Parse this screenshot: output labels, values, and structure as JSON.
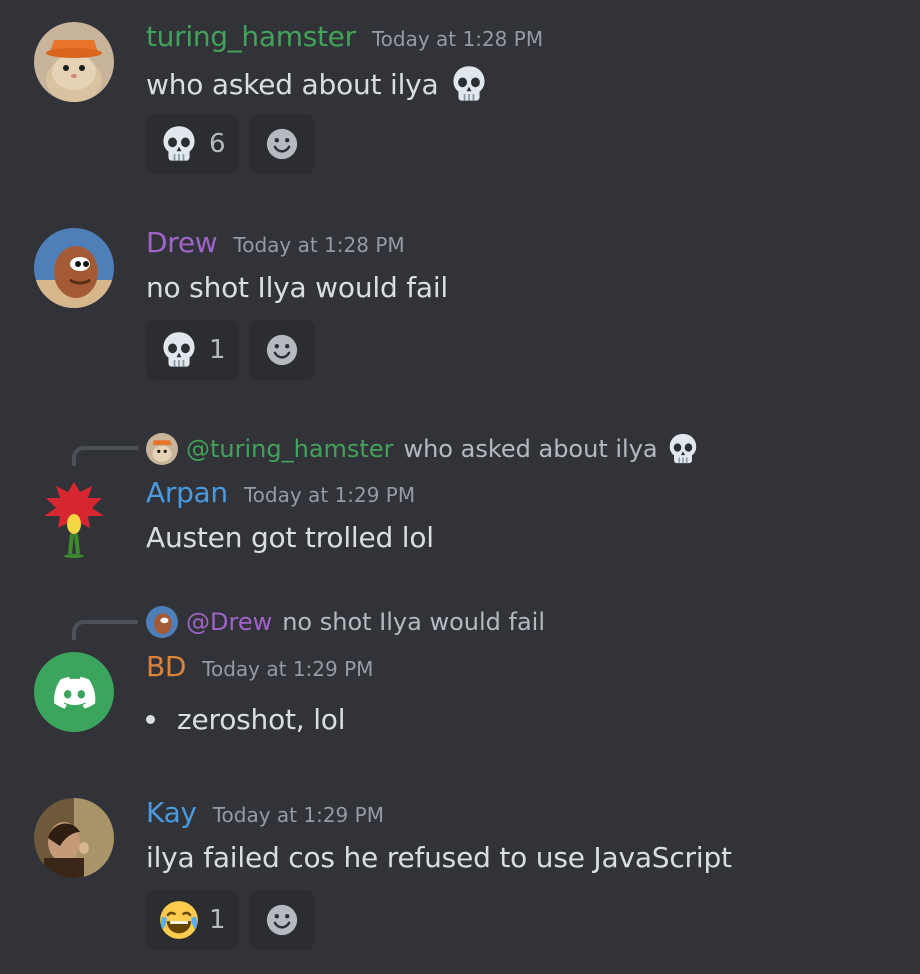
{
  "colors": {
    "background": "#313338",
    "turing_hamster": "#43a25a",
    "drew": "#a064c8",
    "arpan": "#4a9adf",
    "bd": "#d9843a",
    "kay": "#4a9adf",
    "discord_green": "#3ba55d"
  },
  "messages": [
    {
      "username": "turing_hamster",
      "timestamp": "Today at 1:28 PM",
      "content": "who asked about ilya",
      "reactions": [
        {
          "emoji": "skull-icon",
          "count": "6"
        }
      ]
    },
    {
      "username": "Drew",
      "timestamp": "Today at 1:28 PM",
      "content": "no shot Ilya would fail",
      "reactions": [
        {
          "emoji": "skull-icon",
          "count": "1"
        }
      ]
    },
    {
      "reply": {
        "mention": "@turing_hamster",
        "text": "who asked about ilya"
      },
      "username": "Arpan",
      "timestamp": "Today at 1:29 PM",
      "content": "Austen got trolled lol"
    },
    {
      "reply": {
        "mention": "@Drew",
        "text": "no shot Ilya would fail"
      },
      "username": "BD",
      "timestamp": "Today at 1:29 PM",
      "content": "zeroshot, lol"
    },
    {
      "username": "Kay",
      "timestamp": "Today at 1:29 PM",
      "content": "ilya failed cos he refused to use JavaScript",
      "reactions": [
        {
          "emoji": "joy-icon",
          "count": "1"
        }
      ]
    }
  ]
}
